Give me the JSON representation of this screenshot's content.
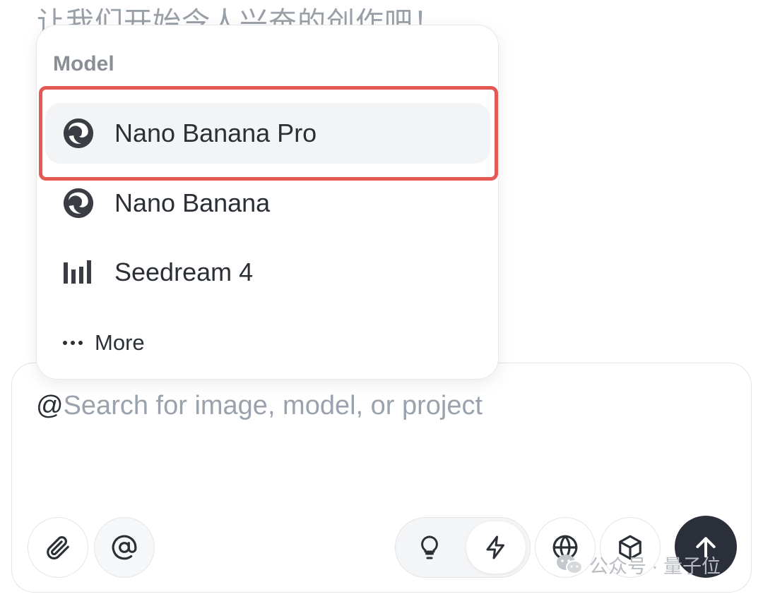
{
  "background": {
    "heading": "让我们开始令人兴奋的创作吧！"
  },
  "model_menu": {
    "title": "Model",
    "items": [
      {
        "label": "Nano Banana Pro",
        "icon": "gemini-swirl-icon",
        "selected": true
      },
      {
        "label": "Nano Banana",
        "icon": "gemini-swirl-icon",
        "selected": false
      },
      {
        "label": "Seedream 4",
        "icon": "bytedance-bars-icon",
        "selected": false
      }
    ],
    "more_label": "More",
    "highlight_color": "#e45a52"
  },
  "composer": {
    "at_prefix": "@",
    "placeholder": "Search for image, model, or project",
    "tools": {
      "attach": "paperclip-icon",
      "mention": "at-sign-icon",
      "idea": "lightbulb-icon",
      "fast": "lightning-icon",
      "web": "globe-icon",
      "three_d": "cube-icon",
      "send": "arrow-up-icon"
    },
    "send_color": "#2b2f3a"
  },
  "watermark": {
    "text": "公众号 · 量子位"
  }
}
